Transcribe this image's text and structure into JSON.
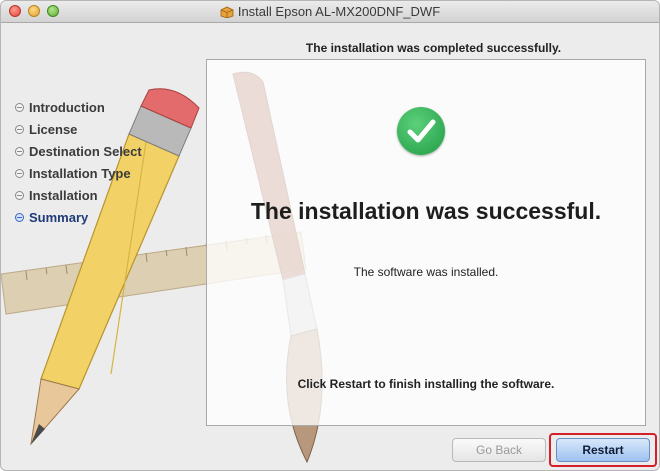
{
  "window": {
    "title": "Install Epson AL-MX200DNF_DWF",
    "title_icon": "package-icon"
  },
  "header": {
    "text": "The installation was completed successfully."
  },
  "sidebar": {
    "items": [
      {
        "label": "Introduction",
        "active": false
      },
      {
        "label": "License",
        "active": false
      },
      {
        "label": "Destination Select",
        "active": false
      },
      {
        "label": "Installation Type",
        "active": false
      },
      {
        "label": "Installation",
        "active": false
      },
      {
        "label": "Summary",
        "active": true
      }
    ]
  },
  "main": {
    "success_title": "The installation was successful.",
    "success_subtitle": "The software was installed.",
    "restart_hint": "Click Restart to finish installing the software.",
    "status_icon": "checkmark-icon",
    "status_color": "#2bb24c"
  },
  "footer": {
    "back_label": "Go Back",
    "restart_label": "Restart",
    "highlight_color": "#d3202a"
  }
}
